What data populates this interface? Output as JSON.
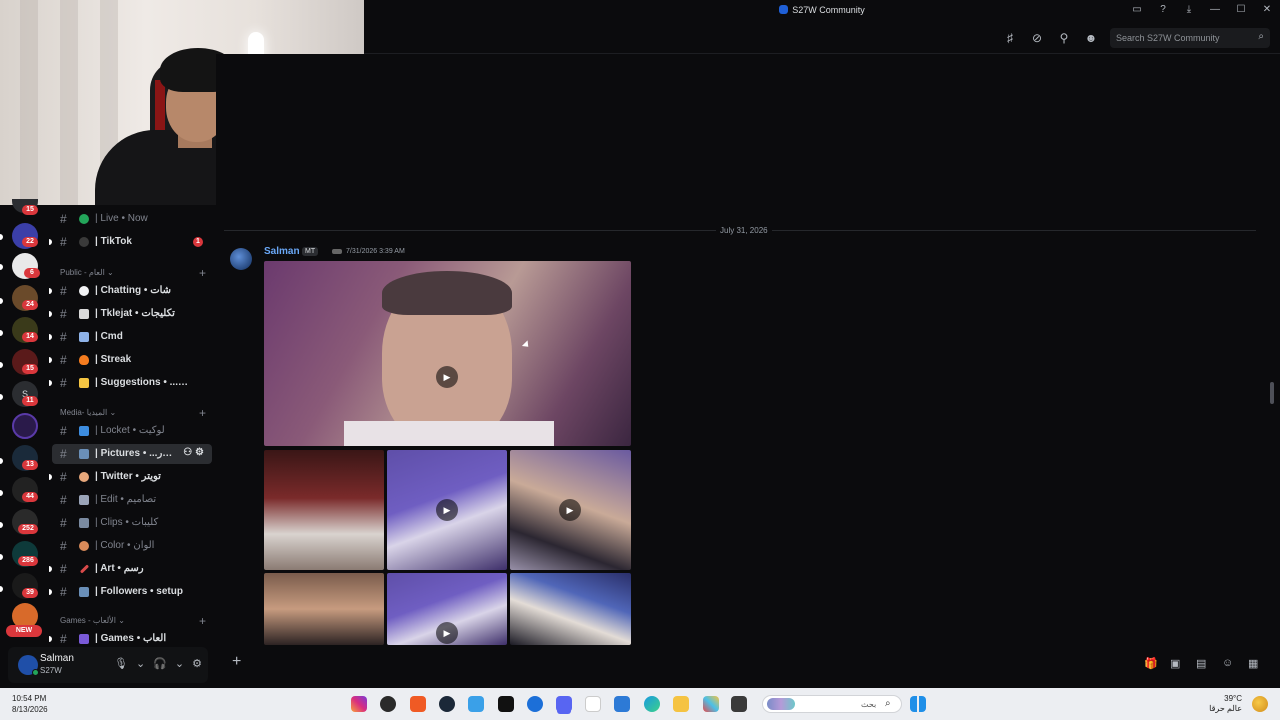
{
  "window": {
    "title": "S27W Community"
  },
  "header": {
    "search_placeholder": "Search S27W Community"
  },
  "servers": [
    {
      "badge": "15"
    },
    {
      "badge": "22"
    },
    {
      "badge": "6"
    },
    {
      "badge": "24"
    },
    {
      "badge": "14"
    },
    {
      "badge": "15"
    },
    {
      "label": "S",
      "badge": "11"
    },
    {
      "badge": ""
    },
    {
      "badge": "13"
    },
    {
      "badge": "44"
    },
    {
      "badge": "252"
    },
    {
      "badge": "286"
    },
    {
      "badge": "39"
    },
    {
      "badge": "NEW"
    }
  ],
  "channels": {
    "live": {
      "label": "| Live • Now"
    },
    "tiktok": {
      "label": "| TikTok",
      "badge": "1"
    },
    "cat_public": "Public - العام",
    "chatting": {
      "label": "| Chatting • شات"
    },
    "tklejat": {
      "label": "| Tklejat • تكليجات"
    },
    "cmd": {
      "label": "| Cmd"
    },
    "streak": {
      "label": "| Streak"
    },
    "suggestions": {
      "label": "| Suggestions • ...احات"
    },
    "cat_media": "Media- الميديا",
    "locket": {
      "label": "| Locket • لوكيت"
    },
    "pictures": {
      "label": "| Pictures • ...سور"
    },
    "twitter": {
      "label": "| Twitter • تويتر"
    },
    "edit": {
      "label": "| Edit • تصاميم"
    },
    "clips": {
      "label": "| Clips • كليبات"
    },
    "color": {
      "label": "| Color • الوان"
    },
    "art": {
      "label": "| Art • رسم"
    },
    "followers": {
      "label": "| Followers • setup"
    },
    "cat_games": "Games - الألعاب",
    "games": {
      "label": "| Games • العاب"
    }
  },
  "user": {
    "name": "Salman",
    "sub": "S27W"
  },
  "message": {
    "date_divider": "July 31, 2026",
    "author": "Salman",
    "tag": "MT",
    "timestamp": "7/31/2026 3:39 AM"
  },
  "taskbar": {
    "time": "10:54 PM",
    "date": "8/13/2026",
    "search_text": "بحث",
    "weather_temp": "39°C",
    "weather_text": "عالم حرقا"
  },
  "colors": {
    "accent": "#6aa8f7",
    "badge": "#da373c",
    "online": "#23a55a"
  }
}
